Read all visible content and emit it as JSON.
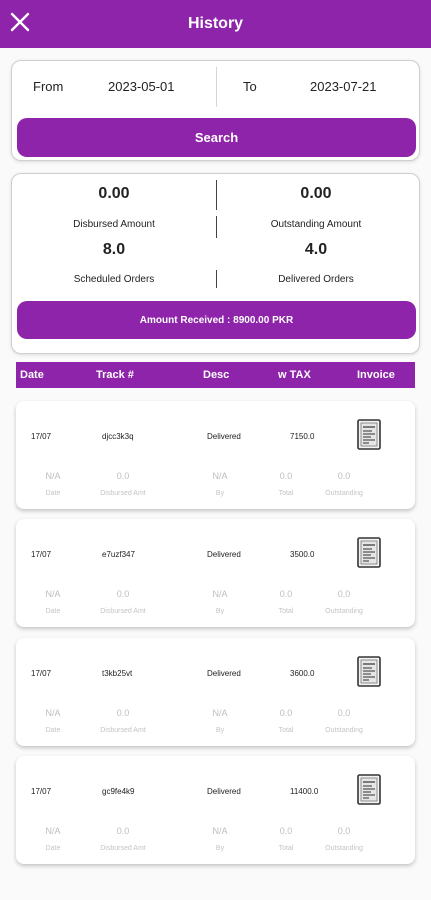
{
  "header": {
    "title": "History"
  },
  "filter": {
    "from_label": "From",
    "from_value": "2023-05-01",
    "to_label": "To",
    "to_value": "2023-07-21",
    "search_label": "Search"
  },
  "summary": {
    "disbursed_value": "0.00",
    "disbursed_label": "Disbursed Amount",
    "outstanding_value": "0.00",
    "outstanding_label": "Outstanding Amount",
    "scheduled_value": "8.0",
    "scheduled_label": "Scheduled Orders",
    "delivered_value": "4.0",
    "delivered_label": "Delivered Orders",
    "amount_received": "Amount Received : 8900.00 PKR"
  },
  "table": {
    "headers": [
      "Date",
      "Track #",
      "Desc",
      "w TAX",
      "Invoice"
    ],
    "rows": [
      {
        "date": "17/07",
        "track": "djcc3k3q",
        "desc": "Delivered",
        "wtax": "7150.0",
        "sub_values": [
          "N/A",
          "0.0",
          "N/A",
          "0.0",
          "0.0"
        ],
        "sub_labels": [
          "Date",
          "Disbursed Amt",
          "By",
          "Total",
          "Outstanding"
        ]
      },
      {
        "date": "17/07",
        "track": "e7uzf347",
        "desc": "Delivered",
        "wtax": "3500.0",
        "sub_values": [
          "N/A",
          "0.0",
          "N/A",
          "0.0",
          "0.0"
        ],
        "sub_labels": [
          "Date",
          "Disbursed Amt",
          "By",
          "Total",
          "Outstanding"
        ]
      },
      {
        "date": "17/07",
        "track": "t3kb25vt",
        "desc": "Delivered",
        "wtax": "3600.0",
        "sub_values": [
          "N/A",
          "0.0",
          "N/A",
          "0.0",
          "0.0"
        ],
        "sub_labels": [
          "Date",
          "Disbursed Amt",
          "By",
          "Total",
          "Outstanding"
        ]
      },
      {
        "date": "17/07",
        "track": "gc9fe4k9",
        "desc": "Delivered",
        "wtax": "11400.0",
        "sub_values": [
          "N/A",
          "0.0",
          "N/A",
          "0.0",
          "0.0"
        ],
        "sub_labels": [
          "Date",
          "Disbursed Amt",
          "By",
          "Total",
          "Outstanding"
        ]
      }
    ]
  },
  "icons": {
    "close": "close-icon",
    "invoice": "invoice-icon"
  },
  "colors": {
    "primary": "#8e24aa",
    "muted_text": "#bdbdbd"
  }
}
